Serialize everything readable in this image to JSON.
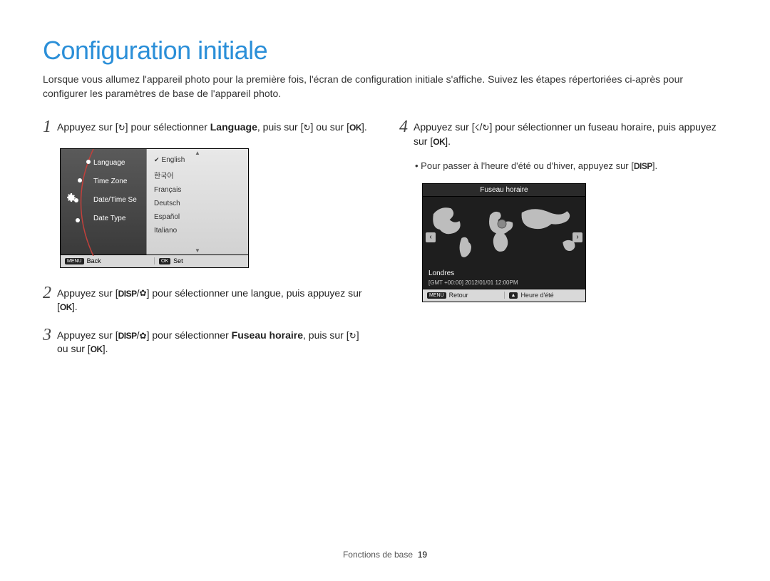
{
  "title": "Configuration initiale",
  "intro": "Lorsque vous allumez l'appareil photo pour la première fois, l'écran de configuration initiale s'affiche. Suivez les étapes répertoriées ci-après pour configurer les paramètres de base de l'appareil photo.",
  "steps": {
    "s1": {
      "num": "1",
      "pre": "Appuyez sur [",
      "icon1": "t",
      "mid1": "] pour sélectionner ",
      "bold": "Language",
      "mid2": ", puis sur [",
      "icon2": "t",
      "mid3": "] ou sur [",
      "icon3": "OK",
      "end": "]."
    },
    "s2": {
      "num": "2",
      "pre": "Appuyez sur [",
      "icon1": "DISP",
      "slash": "/",
      "icon2": "c",
      "mid1": "] pour sélectionner une langue, puis appuyez sur [",
      "icon3": "OK",
      "end": "]."
    },
    "s3": {
      "num": "3",
      "pre": "Appuyez sur [",
      "icon1": "DISP",
      "slash": "/",
      "icon2": "c",
      "mid1": "] pour sélectionner ",
      "bold": "Fuseau horaire",
      "mid2": ", puis sur [",
      "icon3": "t",
      "mid3": "] ou sur [",
      "icon4": "OK",
      "end": "]."
    },
    "s4": {
      "num": "4",
      "pre": "Appuyez sur [",
      "icon1": "F",
      "slash": "/",
      "icon2": "t",
      "mid1": "] pour sélectionner un fuseau horaire, puis appuyez sur [",
      "icon3": "OK",
      "end": "]."
    }
  },
  "bullet4": {
    "text": "Pour passer à l'heure d'été ou d'hiver, appuyez sur [",
    "icon": "DISP",
    "end": "]."
  },
  "lang_panel": {
    "menu": [
      "Language",
      "Time Zone",
      "Date/Time Se",
      "Date Type"
    ],
    "langs": [
      "English",
      "한국어",
      "Français",
      "Deutsch",
      "Español",
      "Italiano"
    ],
    "back_lbl": "MENU",
    "back_text": "Back",
    "set_lbl": "OK",
    "set_text": "Set"
  },
  "tz_panel": {
    "title": "Fuseau horaire",
    "city": "Londres",
    "tz": "[GMT +00:00]  2012/01/01  12:00PM",
    "back_lbl": "MENU",
    "back_text": "Retour",
    "dst_icon": "▲",
    "dst_text": "Heure d'été"
  },
  "footer": {
    "section": "Fonctions de base",
    "page": "19"
  }
}
